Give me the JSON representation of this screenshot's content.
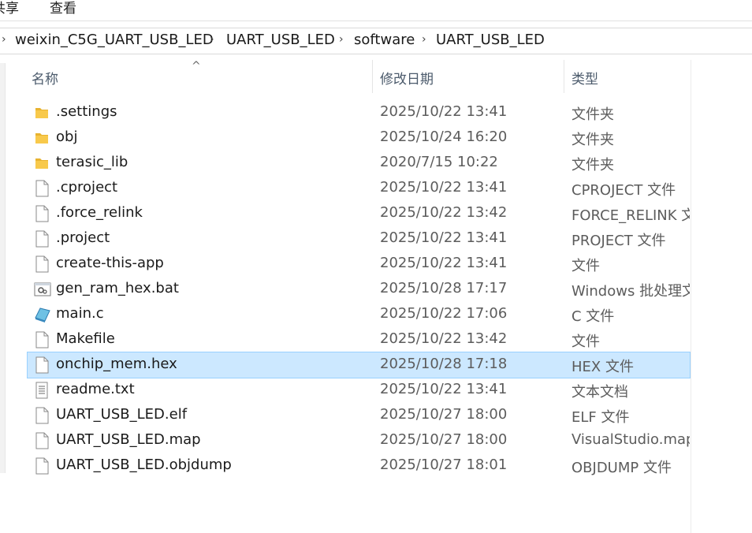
{
  "ribbon": {
    "share_label": "共享",
    "view_label": "查看"
  },
  "breadcrumb": [
    "weixin_C5G_UART_USB_LED",
    "UART_USB_LED",
    "software",
    "UART_USB_LED"
  ],
  "columns": {
    "name": "名称",
    "date": "修改日期",
    "type": "类型"
  },
  "files": [
    {
      "name": ".settings",
      "date": "2025/10/22 13:41",
      "type": "文件夹",
      "icon": "folder-icon"
    },
    {
      "name": "obj",
      "date": "2025/10/24 16:20",
      "type": "文件夹",
      "icon": "folder-icon"
    },
    {
      "name": "terasic_lib",
      "date": "2020/7/15 10:22",
      "type": "文件夹",
      "icon": "folder-icon"
    },
    {
      "name": ".cproject",
      "date": "2025/10/22 13:41",
      "type": "CPROJECT 文件",
      "icon": "file-icon"
    },
    {
      "name": ".force_relink",
      "date": "2025/10/22 13:42",
      "type": "FORCE_RELINK 文件",
      "icon": "file-icon"
    },
    {
      "name": ".project",
      "date": "2025/10/22 13:41",
      "type": "PROJECT 文件",
      "icon": "file-icon"
    },
    {
      "name": "create-this-app",
      "date": "2025/10/22 13:41",
      "type": "文件",
      "icon": "file-icon"
    },
    {
      "name": "gen_ram_hex.bat",
      "date": "2025/10/28 17:17",
      "type": "Windows 批处理文件",
      "icon": "batch-file-icon"
    },
    {
      "name": "main.c",
      "date": "2025/10/22 17:06",
      "type": "C 文件",
      "icon": "c-source-icon"
    },
    {
      "name": "Makefile",
      "date": "2025/10/22 13:42",
      "type": "文件",
      "icon": "file-icon"
    },
    {
      "name": "onchip_mem.hex",
      "date": "2025/10/28 17:18",
      "type": "HEX 文件",
      "icon": "file-icon",
      "selected": true
    },
    {
      "name": "readme.txt",
      "date": "2025/10/22 13:41",
      "type": "文本文档",
      "icon": "text-file-icon"
    },
    {
      "name": "UART_USB_LED.elf",
      "date": "2025/10/27 18:00",
      "type": "ELF 文件",
      "icon": "file-icon"
    },
    {
      "name": "UART_USB_LED.map",
      "date": "2025/10/27 18:00",
      "type": "VisualStudio.map",
      "icon": "file-icon"
    },
    {
      "name": "UART_USB_LED.objdump",
      "date": "2025/10/27 18:01",
      "type": "OBJDUMP 文件",
      "icon": "file-icon"
    }
  ],
  "colors": {
    "selection_bg": "#cce8ff",
    "selection_border": "#99d1ff",
    "folder": "#f8c94b",
    "header_text": "#4b5a6b"
  }
}
